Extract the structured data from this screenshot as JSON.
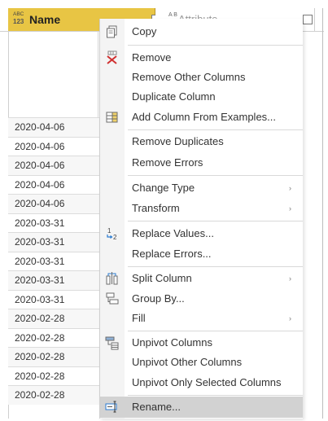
{
  "grid": {
    "name_header": {
      "type_badge_top": "ABC",
      "type_badge_bottom": "123",
      "label": "Name"
    },
    "attribute_header": {
      "type_badge": "A B",
      "label": "Attribute"
    },
    "rows": [
      "2020-04-06",
      "2020-04-06",
      "2020-04-06",
      "2020-04-06",
      "2020-04-06",
      "2020-03-31",
      "2020-03-31",
      "2020-03-31",
      "2020-03-31",
      "2020-03-31",
      "2020-02-28",
      "2020-02-28",
      "2020-02-28",
      "2020-02-28",
      "2020-02-28"
    ]
  },
  "menu": {
    "items": [
      {
        "label": "Copy",
        "icon": "copy-icon"
      },
      {
        "label": "Remove",
        "icon": "remove-icon"
      },
      {
        "label": "Remove Other Columns"
      },
      {
        "label": "Duplicate Column"
      },
      {
        "label": "Add Column From Examples...",
        "icon": "add-column-icon"
      },
      {
        "label": "Remove Duplicates"
      },
      {
        "label": "Remove Errors"
      },
      {
        "label": "Change Type",
        "submenu": "›"
      },
      {
        "label": "Transform",
        "submenu": "›"
      },
      {
        "label": "Replace Values...",
        "icon": "replace-values-icon"
      },
      {
        "label": "Replace Errors..."
      },
      {
        "label": "Split Column",
        "icon": "split-column-icon",
        "submenu": "›"
      },
      {
        "label": "Group By...",
        "icon": "group-by-icon"
      },
      {
        "label": "Fill",
        "submenu": "›"
      },
      {
        "label": "Unpivot Columns",
        "icon": "unpivot-icon"
      },
      {
        "label": "Unpivot Other Columns"
      },
      {
        "label": "Unpivot Only Selected Columns"
      },
      {
        "label": "Rename...",
        "icon": "rename-icon",
        "selected": true
      }
    ]
  },
  "colors": {
    "header_accent": "#e8c544",
    "menu_selected": "#d2d2d2"
  }
}
